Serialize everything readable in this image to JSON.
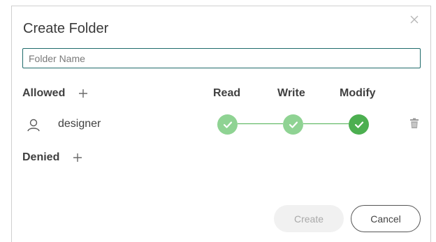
{
  "dialog": {
    "title": "Create Folder",
    "close_icon": "close-icon"
  },
  "folder_name": {
    "value": "",
    "placeholder": "Folder Name"
  },
  "allowed": {
    "label": "Allowed",
    "add_icon": "plus-icon",
    "columns": [
      "Read",
      "Write",
      "Modify"
    ],
    "users": [
      {
        "name": "designer",
        "icon": "user-icon",
        "permissions": {
          "read": true,
          "write": true,
          "modify": true
        },
        "delete_icon": "trash-icon"
      }
    ]
  },
  "denied": {
    "label": "Denied",
    "add_icon": "plus-icon"
  },
  "buttons": {
    "create": "Create",
    "cancel": "Cancel"
  },
  "colors": {
    "accent_border": "#1f6b6b",
    "check_light": "#8fd393",
    "check_dark": "#4caf50",
    "text": "#404040"
  }
}
